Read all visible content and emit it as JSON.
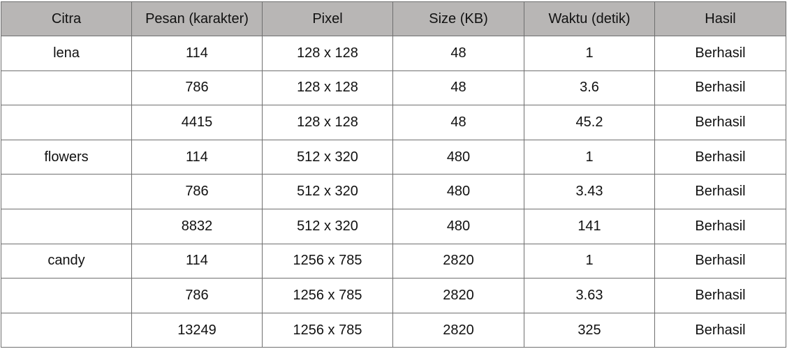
{
  "headers": [
    "Citra",
    "Pesan (karakter)",
    "Pixel",
    "Size (KB)",
    "Waktu (detik)",
    "Hasil"
  ],
  "rows": [
    [
      "lena",
      "114",
      "128 x 128",
      "48",
      "1",
      "Berhasil"
    ],
    [
      "",
      "786",
      "128 x 128",
      "48",
      "3.6",
      "Berhasil"
    ],
    [
      "",
      "4415",
      "128 x 128",
      "48",
      "45.2",
      "Berhasil"
    ],
    [
      "flowers",
      "114",
      "512 x 320",
      "480",
      "1",
      "Berhasil"
    ],
    [
      "",
      "786",
      "512 x 320",
      "480",
      "3.43",
      "Berhasil"
    ],
    [
      "",
      "8832",
      "512 x 320",
      "480",
      "141",
      "Berhasil"
    ],
    [
      "candy",
      "114",
      "1256 x 785",
      "2820",
      "1",
      "Berhasil"
    ],
    [
      "",
      "786",
      "1256 x 785",
      "2820",
      "3.63",
      "Berhasil"
    ],
    [
      "",
      "13249",
      "1256 x 785",
      "2820",
      "325",
      "Berhasil"
    ]
  ],
  "colors": {
    "header_bg": "#b8b6b5",
    "border": "#6f6f6f",
    "text": "#111111"
  }
}
